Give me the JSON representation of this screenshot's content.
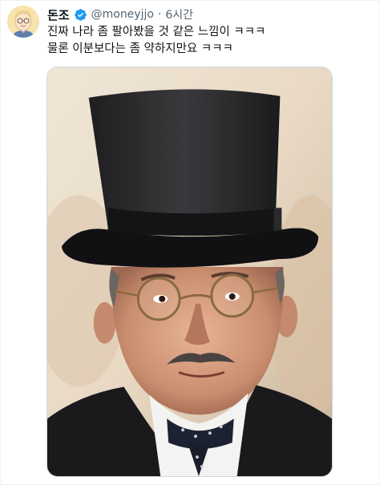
{
  "tweet": {
    "author": {
      "display_name": "돈조",
      "handle": "@moneyjjo",
      "verified": true,
      "avatar_icon": "cartoon-avatar"
    },
    "separator": "·",
    "timestamp": "6시간",
    "text_lines": [
      "진짜 나라 좀 팔아봤을 것 같은 느낌이 ㅋㅋㅋ",
      "물론 이분보다는 좀 약하지만요 ㅋㅋㅋ"
    ],
    "media": {
      "type": "photo",
      "icon": "photo"
    }
  },
  "colors": {
    "verified_blue": "#1d9bf0",
    "secondary_text": "#536471",
    "primary_text": "#0f1419",
    "border": "#cfd9de"
  }
}
